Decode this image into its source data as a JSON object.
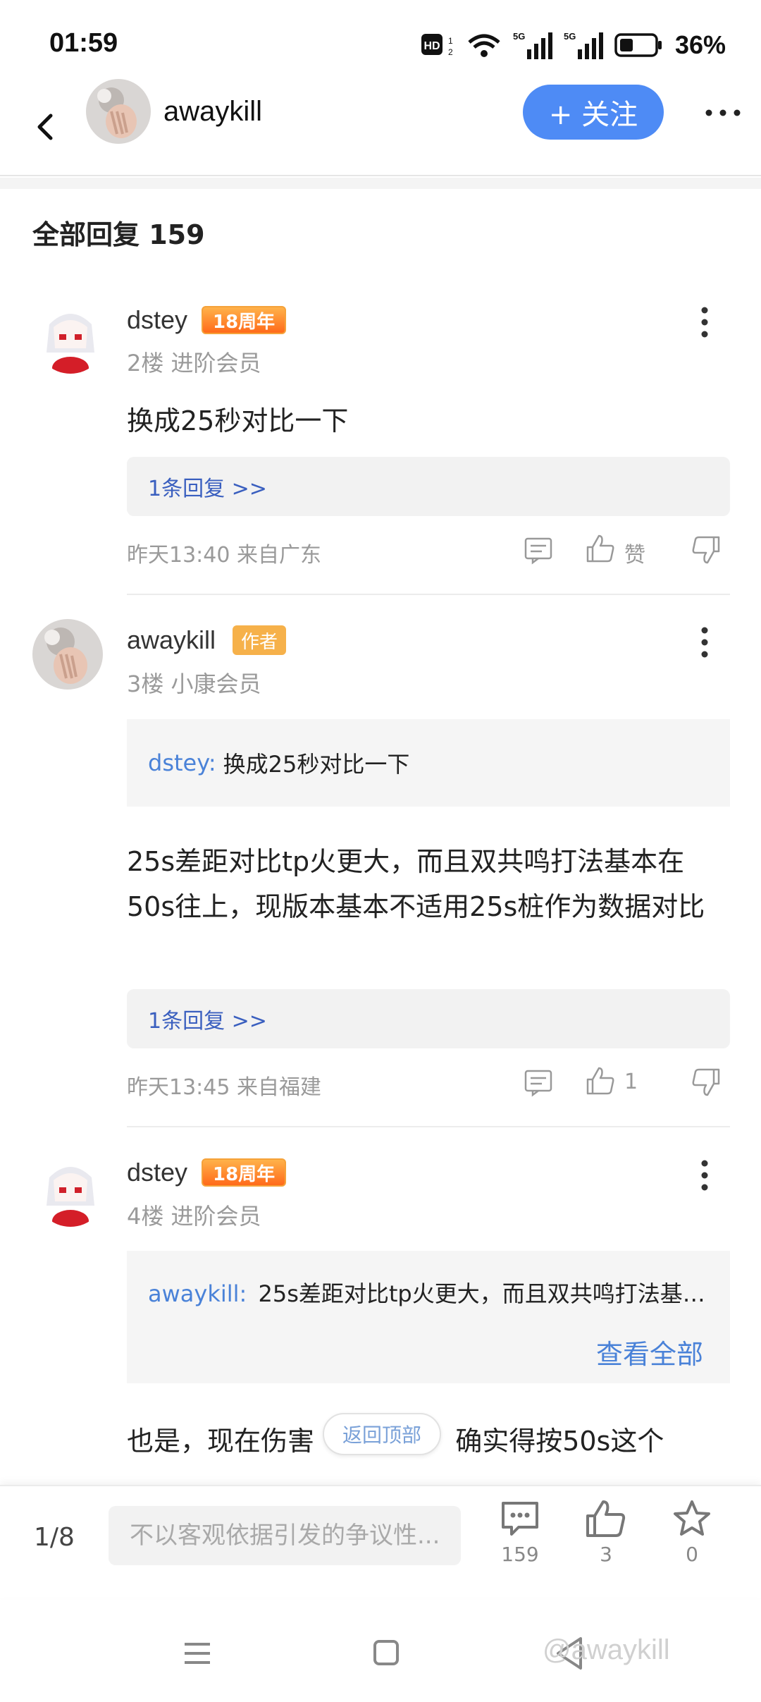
{
  "status_bar": {
    "time": "01:59",
    "battery": "36%",
    "network": "5G"
  },
  "header": {
    "username": "awaykill",
    "follow_label": "+ 关注"
  },
  "section": {
    "title": "全部回复  159"
  },
  "posts": [
    {
      "name": "dstey",
      "badge": "18周年",
      "meta": "2楼 进阶会员",
      "content": "换成25秒对比一下",
      "reply_link": "1条回复 >>",
      "time": "昨天13:40 来自广东",
      "like_label": "赞"
    },
    {
      "name": "awaykill",
      "badge": "作者",
      "meta": "3楼 小康会员",
      "quote_user": "dstey:",
      "quote_text": "换成25秒对比一下",
      "content": "25s差距对比tp火更大，而且双共鸣打法基本在50s往上，现版本基本不适用25s桩作为数据对比",
      "reply_link": "1条回复 >>",
      "time": "昨天13:45 来自福建",
      "like_count": "1"
    },
    {
      "name": "dstey",
      "badge": "18周年",
      "meta": "4楼 进阶会员",
      "quote_user": "awaykill:",
      "quote_text": "25s差距对比tp火更大，而且双共鸣打法基…",
      "view_all": "查看全部",
      "content_a": "也是，现在伤害",
      "content_b": "确实得按50s这个"
    }
  ],
  "back_to_top": "返回顶部",
  "bottom_bar": {
    "page": "1/8",
    "input_placeholder": "不以客观依据引发的争议性...",
    "comment_count": "159",
    "like_count": "3",
    "star_count": "0"
  },
  "watermark": "@awaykill",
  "colors": {
    "accent": "#4e8bf5",
    "link": "#4a82d8",
    "author_badge": "#f6b14a"
  }
}
